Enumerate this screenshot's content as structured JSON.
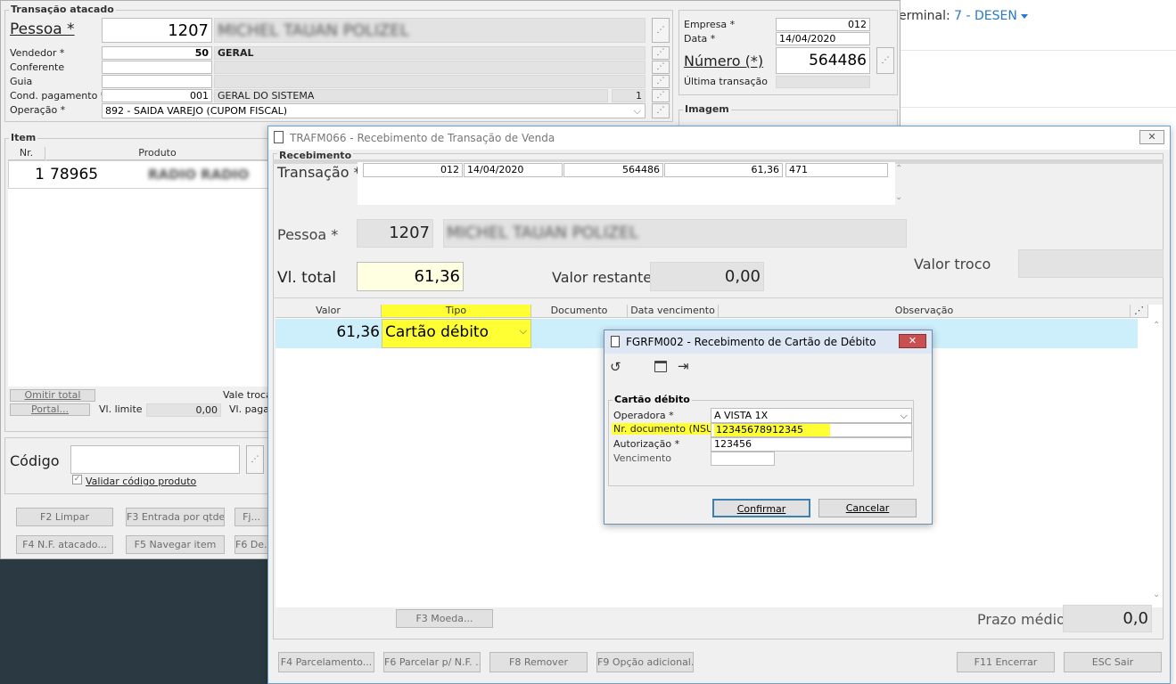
{
  "web": {
    "terminal_prefix": "erminal:",
    "terminal_value": "7 - DESEN"
  },
  "bg": {
    "transacao_group": "Transação atacado",
    "pessoa_label": "Pessoa *",
    "pessoa_code": "1207",
    "pessoa_name": "MICHEL TAUAN POLIZEL",
    "vendedor_label": "Vendedor *",
    "vendedor_code": "50",
    "vendedor_name": "GERAL",
    "conferente_label": "Conferente",
    "guia_label": "Guia",
    "cond_label": "Cond. pagamento *",
    "cond_code": "001",
    "cond_name": "GERAL DO SISTEMA",
    "cond_extra": "1",
    "operacao_label": "Operação *",
    "operacao_value": "892 - SAIDA VAREJO (CUPOM FISCAL)",
    "empresa_label": "Empresa *",
    "empresa_value": "012",
    "data_label": "Data *",
    "data_value": "14/04/2020",
    "numero_label": "Número (*)",
    "numero_value": "564486",
    "ultima_label": "Última transação",
    "imagem_group": "Imagem",
    "item_group": "Item",
    "col_nr": "Nr.",
    "col_produto": "Produto",
    "row_nr": "1",
    "row_code": "78965",
    "row_product": "RADIO RADIO",
    "omitir_btn": "Omitir total",
    "portal_btn": "Portal...",
    "vl_limite_label": "Vl. limite",
    "vl_limite_value": "0,00",
    "vale_troca_label": "Vale troca",
    "vl_pagar_label": "Vl. pagar",
    "codigo_label": "Código",
    "validar_label": "Validar código produto",
    "f2": "F2 Limpar",
    "f3": "F3 Entrada por qtde.",
    "fj": "Fj...",
    "f4": "F4 N.F. atacado...",
    "f5": "F5 Navegar item",
    "f6": "F6 De..."
  },
  "receb": {
    "title": "TRAFM066 - Recebimento de Transação de Venda",
    "group": "Recebimento",
    "transacao_label": "Transação *",
    "t_empresa": "012",
    "t_data": "14/04/2020",
    "t_numero": "564486",
    "t_valor": "61,36",
    "t_extra": "471",
    "pessoa_label": "Pessoa *",
    "pessoa_code": "1207",
    "pessoa_name": "MICHEL TAUAN POLIZEL",
    "vl_total_label": "Vl. total",
    "vl_total_value": "61,36",
    "valor_restante_label": "Valor restante",
    "valor_restante_value": "0,00",
    "valor_troco_label": "Valor troco",
    "grid_headers": {
      "valor": "Valor",
      "tipo": "Tipo",
      "documento": "Documento",
      "data_venc": "Data vencimento",
      "observacao": "Observação"
    },
    "row_valor": "61,36",
    "row_tipo": "Cartão débito",
    "f3_moeda": "F3 Moeda...",
    "prazo_label": "Prazo médio",
    "prazo_value": "0,0",
    "f4": "F4 Parcelamento...",
    "f6": "F6 Parcelar p/ N.F. ...",
    "f8": "F8 Remover",
    "f9": "F9 Opção adicional...",
    "f11": "F11 Encerrar",
    "esc": "ESC Sair"
  },
  "cartao": {
    "title": "FGRFM002 - Recebimento de Cartão de Débito",
    "group": "Cartão débito",
    "operadora_label": "Operadora *",
    "operadora_value": "A VISTA 1X",
    "nsu_label": "Nr. documento (NSU) *",
    "nsu_value": "12345678912345",
    "autorizacao_label": "Autorização *",
    "autorizacao_value": "123456",
    "vencimento_label": "Vencimento",
    "confirmar": "Confirmar",
    "cancelar": "Cancelar"
  },
  "colors": {
    "highlight": "#ffff33",
    "row_selected": "#cdeefb",
    "total_field": "#ffffe1",
    "link": "#2a78c9"
  }
}
